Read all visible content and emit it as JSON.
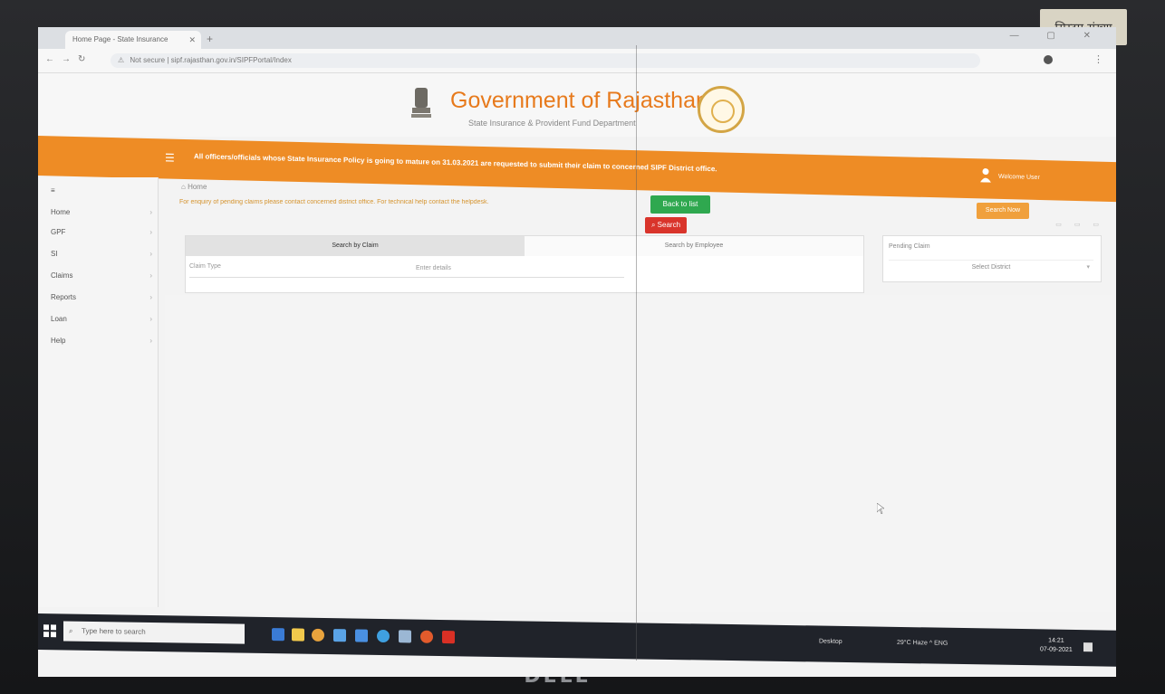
{
  "monitor": {
    "sticker_text": "सिस्टम संख्या",
    "brand": "DELL"
  },
  "browser": {
    "tab_title": "Home Page - State Insurance",
    "new_tab_symbol": "+",
    "window_controls": "— ▢ ✕",
    "address": "Not secure | sipf.rajasthan.gov.in/SIPFPortal/Index",
    "not_secure": "⚠",
    "menu_symbol": "⋮"
  },
  "header": {
    "title": "Government of Rajasthan",
    "subtitle": "State Insurance & Provident Fund Department"
  },
  "notice": {
    "text": "All officers/officials whose State Insurance Policy is going to mature on 31.03.2021 are requested to submit their claim to concerned SIPF District office.",
    "user": "Welcome User"
  },
  "sidebar": {
    "items": [
      {
        "label": "≡"
      },
      {
        "label": "Home"
      },
      {
        "label": "GPF"
      },
      {
        "label": "SI"
      },
      {
        "label": "Claims"
      },
      {
        "label": "Reports"
      },
      {
        "label": "Loan"
      },
      {
        "label": "Help"
      }
    ]
  },
  "main": {
    "breadcrumb": "Home",
    "help_line": "For enquiry of pending claims please contact concerned district office. For technical help contact the helpdesk.",
    "back_button": "Back to list",
    "right_button": "Search Now",
    "tabs": [
      "Search by Claim",
      "Search by Employee"
    ],
    "field_label": "Claim Type",
    "field_placeholder": "Enter details",
    "search_button": "Search",
    "right_box_label": "Pending Claim",
    "right_box_select": "Select District",
    "mini_icons": "▭ ▭ ▭"
  },
  "taskbar": {
    "search_placeholder": "Type here to search",
    "tray_left": "Desktop",
    "tray_right": "29°C Haze ^ ENG",
    "time": "14:21",
    "date": "07-09-2021"
  }
}
